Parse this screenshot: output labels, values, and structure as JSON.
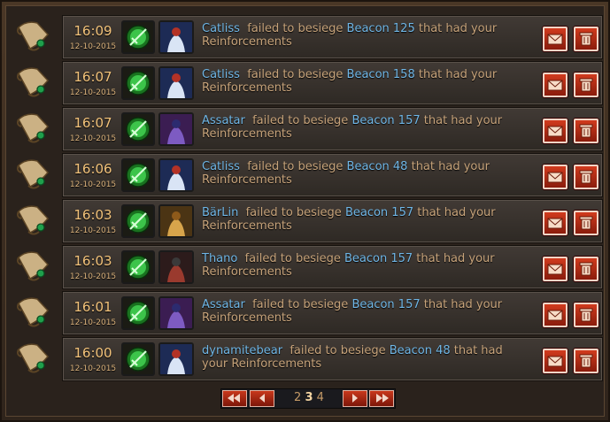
{
  "ui": {
    "colors": {
      "panel": "#3b3530",
      "name": "#6fb6e6",
      "text": "#c7a37a",
      "time": "#f2c27a",
      "button": "#c8381c"
    },
    "connector_text": {
      "failed": "failed to besiege",
      "beacon": "Beacon",
      "that_had": "that had your Reinforcements"
    }
  },
  "reports": [
    {
      "time": "16:09",
      "date": "12-10-2015",
      "player": "Catliss",
      "beacon_num": "125",
      "avatar": "white-blue-robed-hero"
    },
    {
      "time": "16:07",
      "date": "12-10-2015",
      "player": "Catliss",
      "beacon_num": "158",
      "avatar": "white-blue-robed-hero"
    },
    {
      "time": "16:07",
      "date": "12-10-2015",
      "player": "Assatar",
      "beacon_num": "157",
      "avatar": "purple-armored-knight"
    },
    {
      "time": "16:06",
      "date": "12-10-2015",
      "player": "Catliss",
      "beacon_num": "48",
      "avatar": "white-blue-robed-hero"
    },
    {
      "time": "16:03",
      "date": "12-10-2015",
      "player": "BärLin",
      "beacon_num": "157",
      "avatar": "golden-armored-warrior"
    },
    {
      "time": "16:03",
      "date": "12-10-2015",
      "player": "Thano",
      "beacon_num": "157",
      "avatar": "dark-armored-warrior"
    },
    {
      "time": "16:01",
      "date": "12-10-2015",
      "player": "Assatar",
      "beacon_num": "157",
      "avatar": "purple-armored-knight"
    },
    {
      "time": "16:00",
      "date": "12-10-2015",
      "player": "dynamitebear",
      "beacon_num": "48",
      "avatar": "white-blue-robed-hero"
    }
  ],
  "pager": {
    "pages": [
      "2",
      "3",
      "4"
    ],
    "current": "3"
  }
}
